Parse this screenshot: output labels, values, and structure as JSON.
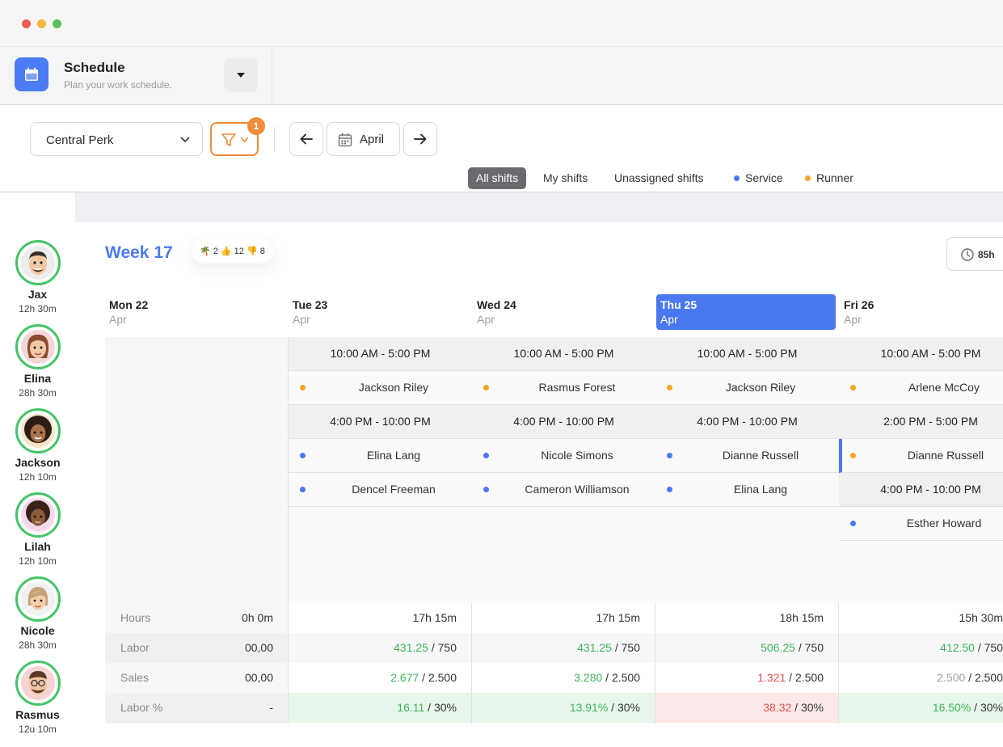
{
  "app": {
    "title": "Schedule",
    "subtitle": "Plan your work schedule."
  },
  "toolbar": {
    "location": "Central Perk",
    "filter_count": "1",
    "month": "April"
  },
  "tabs": [
    {
      "label": "All shifts",
      "active": true
    },
    {
      "label": "My shifts",
      "active": false
    },
    {
      "label": "Unassigned shifts",
      "active": false
    },
    {
      "label": "Service",
      "color": "#4a78f0"
    },
    {
      "label": "Runner",
      "color": "#f5a623"
    }
  ],
  "people": [
    {
      "name": "Jax",
      "hours": "12h 30m"
    },
    {
      "name": "Elina",
      "hours": "28h 30m"
    },
    {
      "name": "Jackson",
      "hours": "12h 10m"
    },
    {
      "name": "Lilah",
      "hours": "12h 10m"
    },
    {
      "name": "Nicole",
      "hours": "28h 30m"
    },
    {
      "name": "Rasmus",
      "hours": "12u 10m"
    }
  ],
  "week": {
    "title": "Week 17",
    "stats": "🌴 2  👍 12  👎 8",
    "total_hours": "85h"
  },
  "days": [
    {
      "day": "Mon 22",
      "month": "Apr",
      "today": false
    },
    {
      "day": "Tue 23",
      "month": "Apr",
      "today": false
    },
    {
      "day": "Wed 24",
      "month": "Apr",
      "today": false
    },
    {
      "day": "Thu 25",
      "month": "Apr",
      "today": true
    },
    {
      "day": "Fri 26",
      "month": "Apr",
      "today": false
    }
  ],
  "shifts": {
    "tue": [
      {
        "type": "time",
        "text": "10:00 AM - 5:00 PM"
      },
      {
        "type": "person",
        "text": "Jackson Riley",
        "role": "runner"
      },
      {
        "type": "time",
        "text": "4:00 PM - 10:00 PM"
      },
      {
        "type": "person",
        "text": "Elina Lang",
        "role": "service"
      },
      {
        "type": "person",
        "text": "Dencel Freeman",
        "role": "service"
      }
    ],
    "wed": [
      {
        "type": "time",
        "text": "10:00 AM - 5:00 PM"
      },
      {
        "type": "person",
        "text": "Rasmus Forest",
        "role": "runner"
      },
      {
        "type": "time",
        "text": "4:00 PM - 10:00 PM"
      },
      {
        "type": "person",
        "text": "Nicole Simons",
        "role": "service"
      },
      {
        "type": "person",
        "text": "Cameron Williamson",
        "role": "service"
      }
    ],
    "thu": [
      {
        "type": "time",
        "text": "10:00 AM - 5:00 PM"
      },
      {
        "type": "person",
        "text": "Jackson Riley",
        "role": "runner"
      },
      {
        "type": "time",
        "text": "4:00 PM - 10:00 PM"
      },
      {
        "type": "person",
        "text": "Dianne Russell",
        "role": "service"
      },
      {
        "type": "person",
        "text": "Elina Lang",
        "role": "service"
      }
    ],
    "fri": [
      {
        "type": "time",
        "text": "10:00 AM - 5:00 PM"
      },
      {
        "type": "person",
        "text": "Arlene McCoy",
        "role": "runner"
      },
      {
        "type": "time",
        "text": "2:00 PM - 5:00 PM"
      },
      {
        "type": "person",
        "text": "Dianne Russell",
        "role": "runner"
      },
      {
        "type": "time",
        "text": "4:00 PM - 10:00 PM"
      },
      {
        "type": "person",
        "text": "Esther Howard",
        "role": "service"
      }
    ]
  },
  "stats": {
    "labels": [
      "Hours",
      "Labor",
      "Sales",
      "Labor %"
    ],
    "mon": [
      "0h 0m",
      "00,00",
      "00,00",
      "-"
    ],
    "tue": {
      "hours": "17h 15m",
      "labor": "431.25",
      "labor_target": " / 750",
      "sales": "2.677",
      "sales_target": " / 2.500",
      "labor_pct": "16.11",
      "labor_pct_target": " / 30%"
    },
    "wed": {
      "hours": "17h 15m",
      "labor": "431.25",
      "labor_target": " / 750",
      "sales": "3.280",
      "sales_target": " / 2.500",
      "labor_pct": "13.91%",
      "labor_pct_target": " / 30%"
    },
    "thu": {
      "hours": "18h 15m",
      "labor": "506.25",
      "labor_target": " / 750",
      "sales": "1.321",
      "sales_target": " / 2.500",
      "labor_pct": "38.32",
      "labor_pct_target": " / 30%"
    },
    "fri": {
      "hours": "15h 30m",
      "labor": "412.50",
      "labor_target": " / 750",
      "sales": "2.500",
      "sales_target": " / 2.500",
      "labor_pct": "16.50%",
      "labor_pct_target": " / 30%"
    }
  },
  "colors": {
    "accent": "#4a78f0",
    "service": "#4a78f0",
    "runner": "#f5a623",
    "filter": "#f08c3a",
    "good": "#3fb45a",
    "bad": "#e25252",
    "good_bg": "#e6f6ea",
    "bad_bg": "#fbe8e8"
  }
}
